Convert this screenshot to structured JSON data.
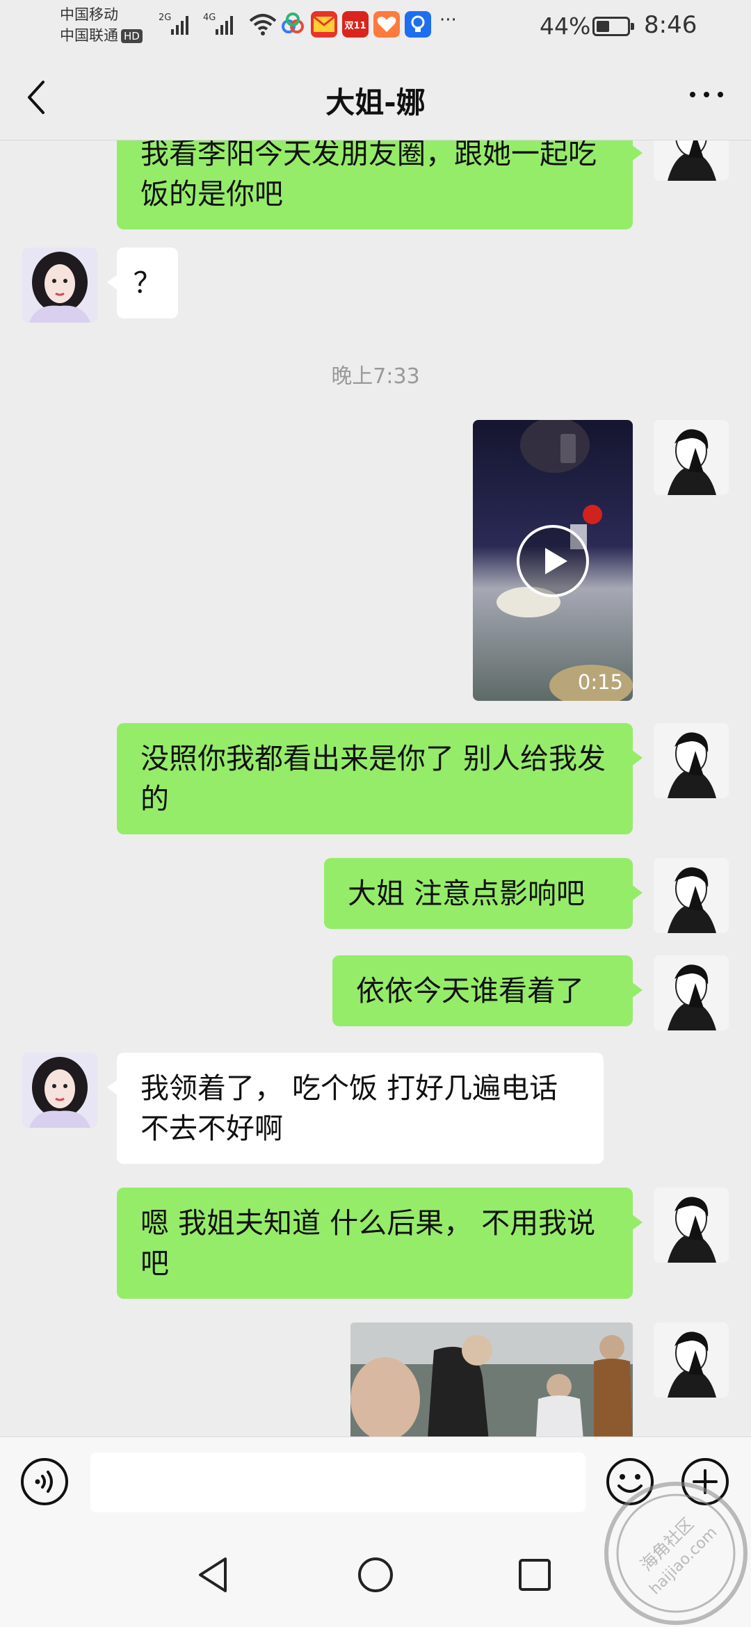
{
  "status_bar": {
    "carrier_1": "中国移动",
    "carrier_2": "中国联通",
    "hd": "HD",
    "signal_1": "2G",
    "signal_2": "4G",
    "app_badge_1": "双11",
    "more": "···",
    "battery": "44%",
    "time": "8:46"
  },
  "header": {
    "title": "大姐-娜"
  },
  "messages": [
    {
      "side": "out",
      "text": "我看李阳今天发朋友圈，跟她一起吃饭的是你吧"
    },
    {
      "side": "in",
      "text": "？"
    },
    {
      "type": "time",
      "text": "晚上7:33"
    },
    {
      "side": "out",
      "type": "video",
      "duration": "0:15"
    },
    {
      "side": "out",
      "text": "没照你我都看出来是你了 别人给我发的"
    },
    {
      "side": "out",
      "text": "大姐 注意点影响吧"
    },
    {
      "side": "out",
      "text": "依依今天谁看着了"
    },
    {
      "side": "in",
      "text": "我领着了， 吃个饭  打好几遍电话  不去不好啊"
    },
    {
      "side": "out",
      "text": "嗯  我姐夫知道 什么后果， 不用我说吧"
    },
    {
      "side": "out",
      "type": "image"
    }
  ],
  "input": {
    "value": "",
    "placeholder": ""
  },
  "watermark": {
    "line1": "海角社区",
    "line2": "haijiao.com"
  },
  "colors": {
    "outgoing_bubble": "#95ec69",
    "incoming_bubble": "#ffffff",
    "background": "#ededed"
  }
}
